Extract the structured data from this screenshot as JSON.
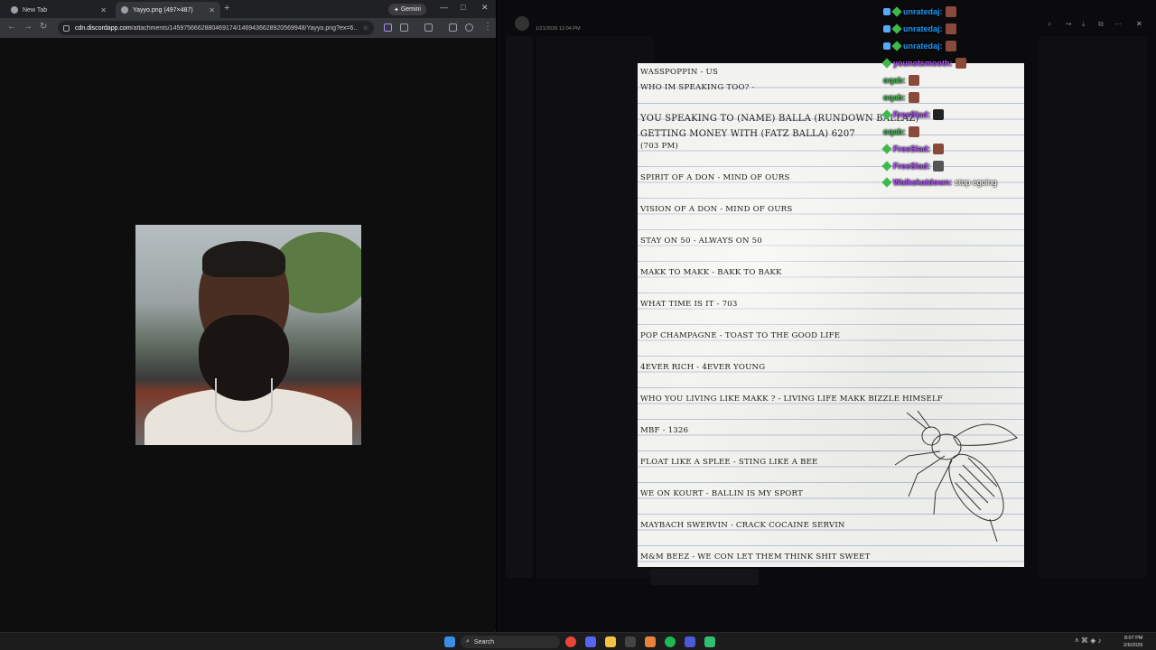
{
  "chrome": {
    "tabs": [
      {
        "label": "New Tab"
      },
      {
        "label": "Yayyo.png (497×487)"
      }
    ],
    "gemini_label": "Gemini",
    "url_host": "cdn.discordapp.com",
    "url_path": "/attachments/1459756662880469174/1469436628920569948/Yayyo.png?ex=6..."
  },
  "discord": {
    "post_date": "1/21/2026 12:04 PM"
  },
  "note_lines": [
    "WASSPOPPIN - US",
    "WHO IM SPEAKING TOO? -",
    "YOU SPEAKING TO (NAME) BALLA (RUNDOWN BALLAZ)",
    "GETTING MONEY WITH (FATZ BALLA) 6207",
    "(703 PM)",
    "SPIRIT OF A DON - MIND OF OURS",
    "VISION OF A DON - MIND OF OURS",
    "STAY ON 50 - ALWAYS ON 50",
    "MAKK TO MAKK - BAKK TO BAKK",
    "WHAT TIME IS IT - 703",
    "POP CHAMPAGNE - TOAST TO THE GOOD LIFE",
    "4EVER RICH - 4EVER YOUNG",
    "WHO YOU LIVING LIKE MAKK ? - LIVING LIFE MAKK BIZZLE HIMSELF",
    "MBF - 1326",
    "FLOAT LIKE A SPLEE - STING LIKE A BEE",
    "WE ON KOURT - BALLIN IS MY SPORT",
    "MAYBACH SWERVIN - CRACK COCAINE SERVIN",
    "M&M BEEZ - WE CON LET THEM THINK SHIT SWEET"
  ],
  "chat": [
    {
      "user": "unratedaj:",
      "color": "#1a9bff",
      "text": ""
    },
    {
      "user": "unratedaj:",
      "color": "#1a9bff",
      "text": ""
    },
    {
      "user": "unratedaj:",
      "color": "#1a9bff",
      "text": ""
    },
    {
      "user": "younotsmooth:",
      "color": "#b04dff",
      "text": ""
    },
    {
      "user": "oqab:",
      "color": "#3fb94c",
      "text": ""
    },
    {
      "user": "oqab:",
      "color": "#3fb94c",
      "text": ""
    },
    {
      "user": "FreeSlad:",
      "color": "#b04dff",
      "text": ""
    },
    {
      "user": "oqab:",
      "color": "#3fb94c",
      "text": ""
    },
    {
      "user": "FreeSlad:",
      "color": "#b04dff",
      "text": ""
    },
    {
      "user": "FreeSlad:",
      "color": "#b04dff",
      "text": ""
    },
    {
      "user": "Walkskatdown:",
      "color": "#b04dff",
      "text": "stop egoing"
    }
  ],
  "taskbar": {
    "search_label": "Search",
    "time": "8:07 PM",
    "date": "2/6/2026"
  }
}
